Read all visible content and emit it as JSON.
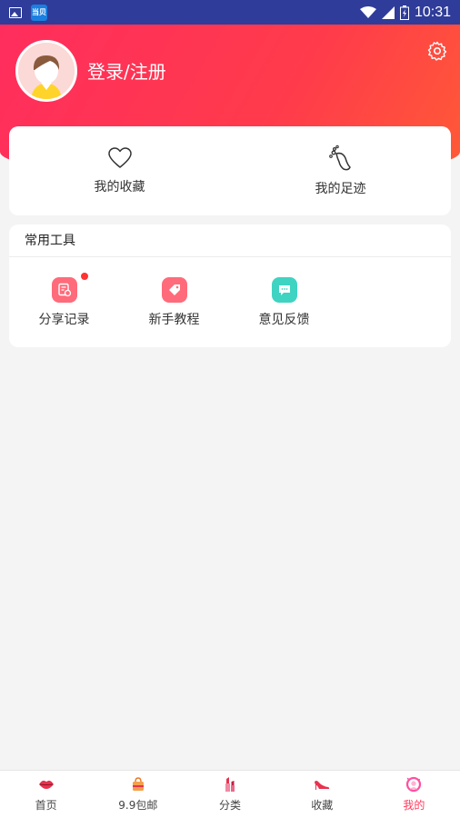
{
  "status_bar": {
    "time": "10:31",
    "app_badge": "当贝"
  },
  "header": {
    "login_label": "登录/注册"
  },
  "favorites": [
    {
      "label": "我的收藏",
      "icon": "heart-icon"
    },
    {
      "label": "我的足迹",
      "icon": "footprint-icon"
    }
  ],
  "tools": {
    "title": "常用工具",
    "items": [
      {
        "label": "分享记录",
        "icon": "share-record-icon",
        "color": "#ff6b7a",
        "has_badge": true
      },
      {
        "label": "新手教程",
        "icon": "tag-icon",
        "color": "#ff6b7a",
        "has_badge": false
      },
      {
        "label": "意见反馈",
        "icon": "chat-icon",
        "color": "#3fd3c2",
        "has_badge": false
      }
    ]
  },
  "bottom_nav": [
    {
      "label": "首页",
      "icon": "lips-icon",
      "active": false
    },
    {
      "label": "9.9包邮",
      "icon": "bag-icon",
      "active": false
    },
    {
      "label": "分类",
      "icon": "lipstick-icon",
      "active": false
    },
    {
      "label": "收藏",
      "icon": "high-heel-icon",
      "active": false
    },
    {
      "label": "我的",
      "icon": "profile-icon",
      "active": true
    }
  ],
  "colors": {
    "accent": "#ff3a5c",
    "status_bar": "#2f3c99"
  }
}
